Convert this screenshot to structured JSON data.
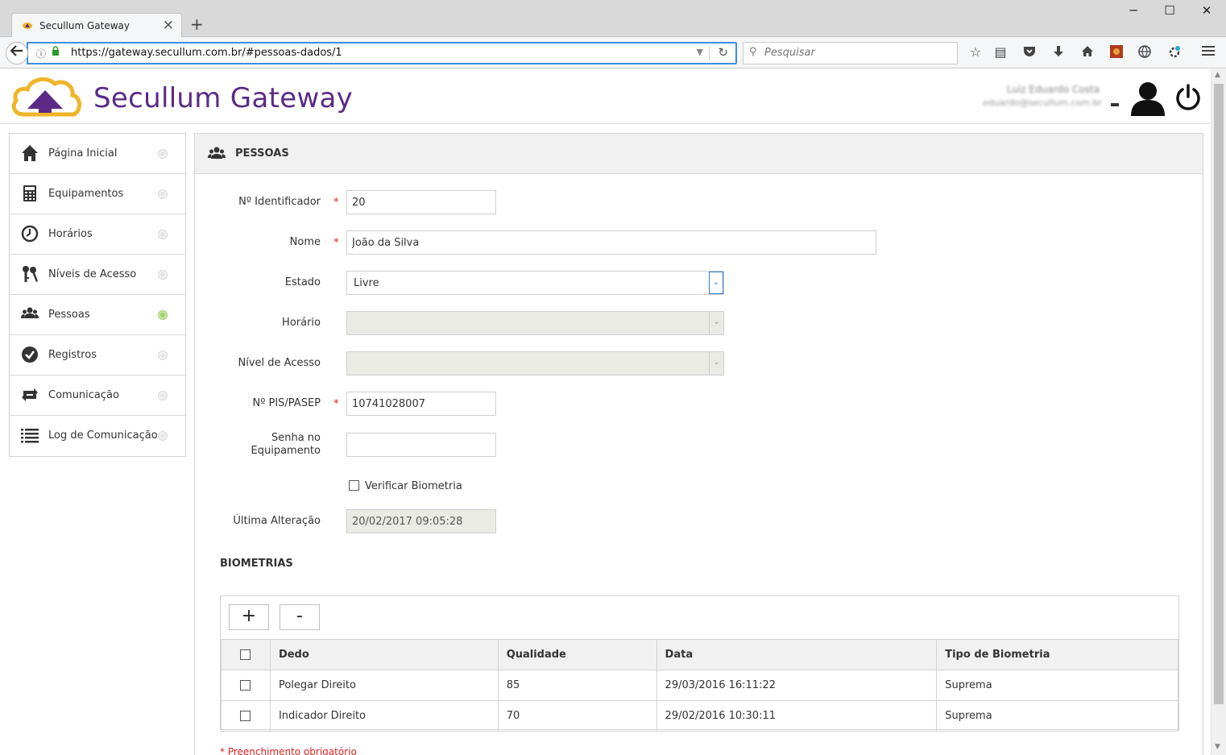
{
  "browser": {
    "tab_title": "Secullum Gateway",
    "url": "https://gateway.secullum.com.br/#pessoas-dados/1",
    "search_placeholder": "Pesquisar",
    "window_controls": {
      "minimize": "─",
      "maximize": "☐",
      "close": "✕"
    },
    "toolbar_icons": [
      "bookmark-star-icon",
      "reading-list-icon",
      "pocket-icon",
      "downloads-icon",
      "home-icon",
      "addon-icon",
      "globe-icon",
      "settings-icon",
      "menu-icon"
    ]
  },
  "app": {
    "title": "Secullum Gateway",
    "brand_color": "#5b2a86",
    "user_name": "Luiz Eduardo Costa",
    "user_email": "eduardo@secullum.com.br"
  },
  "sidebar": {
    "items": [
      {
        "label": "Página Inicial",
        "icon": "home-icon",
        "active": false
      },
      {
        "label": "Equipamentos",
        "icon": "calculator-icon",
        "active": false
      },
      {
        "label": "Horários",
        "icon": "clock-icon",
        "active": false
      },
      {
        "label": "Níveis de Acesso",
        "icon": "keys-icon",
        "active": false
      },
      {
        "label": "Pessoas",
        "icon": "people-icon",
        "active": true
      },
      {
        "label": "Registros",
        "icon": "check-circle-icon",
        "active": false
      },
      {
        "label": "Comunicação",
        "icon": "sync-icon",
        "active": false
      },
      {
        "label": "Log de Comunicação",
        "icon": "list-icon",
        "active": false
      }
    ]
  },
  "panel": {
    "title": "PESSOAS",
    "fields": {
      "identificador": {
        "label": "Nº Identificador",
        "value": "20",
        "required": "*"
      },
      "nome": {
        "label": "Nome",
        "value": "João da Silva",
        "required": "*"
      },
      "estado": {
        "label": "Estado",
        "value": "Livre"
      },
      "horario": {
        "label": "Horário",
        "value": ""
      },
      "nivel": {
        "label": "Nível de Acesso",
        "value": ""
      },
      "pis": {
        "label": "Nº PIS/PASEP",
        "value": "10741028007",
        "required": "*"
      },
      "senha_l1": "Senha no",
      "senha_l2": "Equipamento",
      "senha_value": "",
      "biometria": {
        "label": "Verificar Biometria",
        "checked": false
      },
      "ultima": {
        "label": "Última Alteração",
        "value": "20/02/2017 09:05:28"
      }
    },
    "biometrias": {
      "title": "BIOMETRIAS",
      "add_label": "+",
      "remove_label": "-",
      "columns": [
        "Dedo",
        "Qualidade",
        "Data",
        "Tipo de Biometria"
      ],
      "rows": [
        {
          "dedo": "Polegar Direito",
          "qualidade": "85",
          "data": "29/03/2016 16:11:22",
          "tipo": "Suprema"
        },
        {
          "dedo": "Indicador Direito",
          "qualidade": "70",
          "data": "29/02/2016 10:30:11",
          "tipo": "Suprema"
        }
      ]
    },
    "required_note": "* Preenchimento obrigatório"
  }
}
